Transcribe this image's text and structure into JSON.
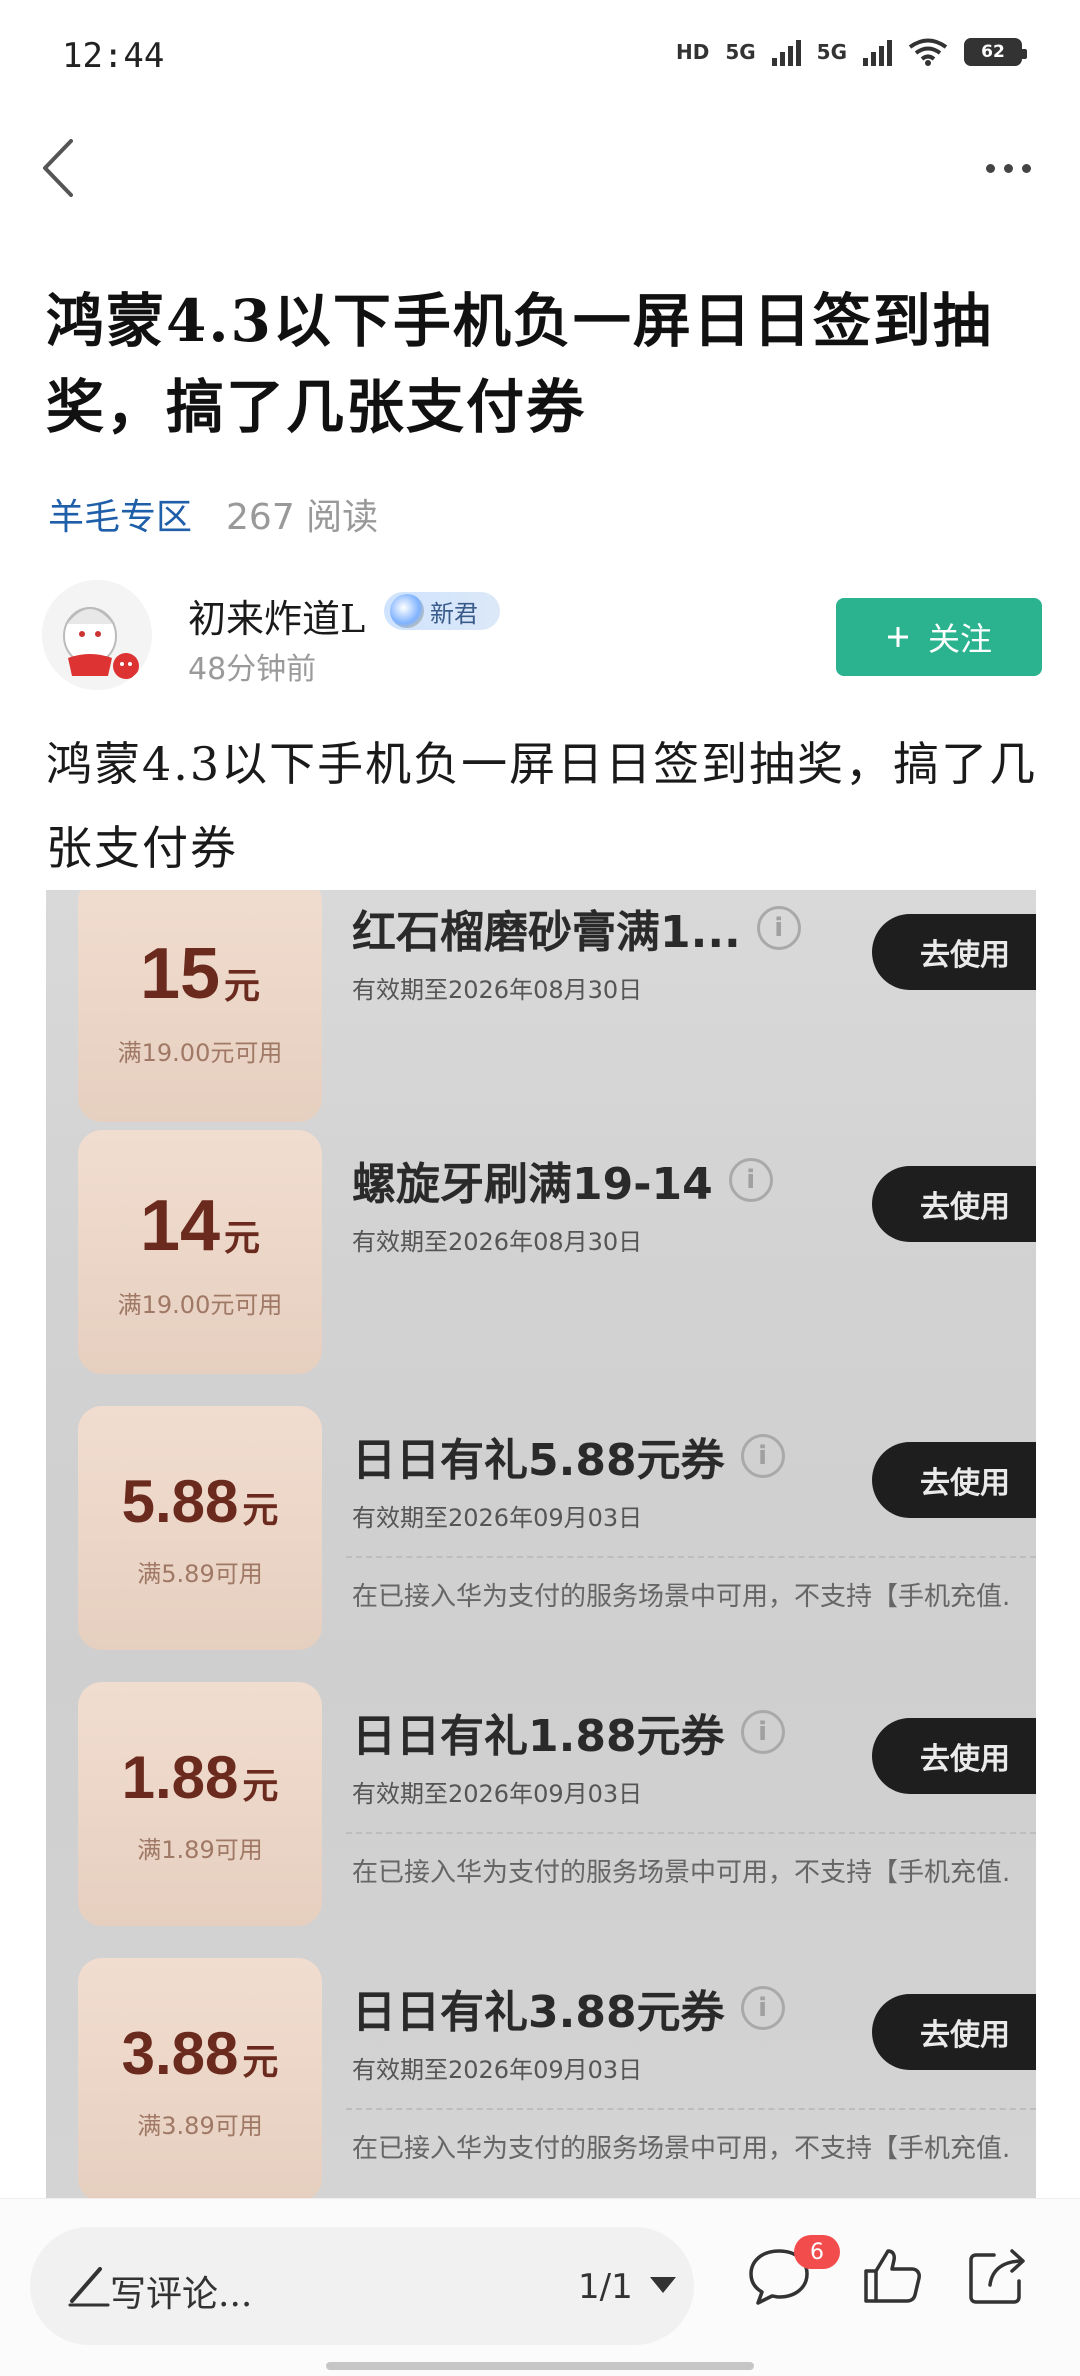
{
  "status_bar": {
    "time": "12:44",
    "network_hd": "HD",
    "signal1_label": "5G",
    "signal2_label": "5G",
    "battery": "62"
  },
  "nav": {
    "back_icon": "chevron-left-icon",
    "more_icon": "more-horizontal-icon"
  },
  "post": {
    "title": "鸿蒙4.3以下手机负一屏日日签到抽奖，搞了几张支付券",
    "category": "羊毛专区",
    "reads": "267 阅读",
    "author": {
      "name": "初来炸道L",
      "badge": "新君",
      "time": "48分钟前",
      "follow_label": "关注"
    },
    "body": "鸿蒙4.3以下手机负一屏日日签到抽奖，搞了几张支付券"
  },
  "coupons": [
    {
      "amount": "15",
      "unit": "元",
      "condition": "满19.00元可用",
      "name": "红石榴磨砂膏满1...",
      "valid": "有效期至2026年08月30日",
      "desc": "",
      "button": "去使用"
    },
    {
      "amount": "14",
      "unit": "元",
      "condition": "满19.00元可用",
      "name": "螺旋牙刷满19-14",
      "valid": "有效期至2026年08月30日",
      "desc": "",
      "button": "去使用"
    },
    {
      "amount": "5.88",
      "unit": "元",
      "condition": "满5.89可用",
      "name": "日日有礼5.88元券",
      "valid": "有效期至2026年09月03日",
      "desc": "在已接入华为支付的服务场景中可用，不支持【手机充值...",
      "button": "去使用"
    },
    {
      "amount": "1.88",
      "unit": "元",
      "condition": "满1.89可用",
      "name": "日日有礼1.88元券",
      "valid": "有效期至2026年09月03日",
      "desc": "在已接入华为支付的服务场景中可用，不支持【手机充值...",
      "button": "去使用"
    },
    {
      "amount": "3.88",
      "unit": "元",
      "condition": "满3.89可用",
      "name": "日日有礼3.88元券",
      "valid": "有效期至2026年09月03日",
      "desc": "在已接入华为支付的服务场景中可用，不支持【手机充值...",
      "button": "去使用"
    }
  ],
  "bottom_bar": {
    "comment_placeholder": "写评论...",
    "page_indicator": "1/1",
    "comment_count": "6"
  },
  "colors": {
    "category": "#1f5ea8",
    "follow_button": "#2ab38e",
    "badge_red": "#f34c4c"
  }
}
